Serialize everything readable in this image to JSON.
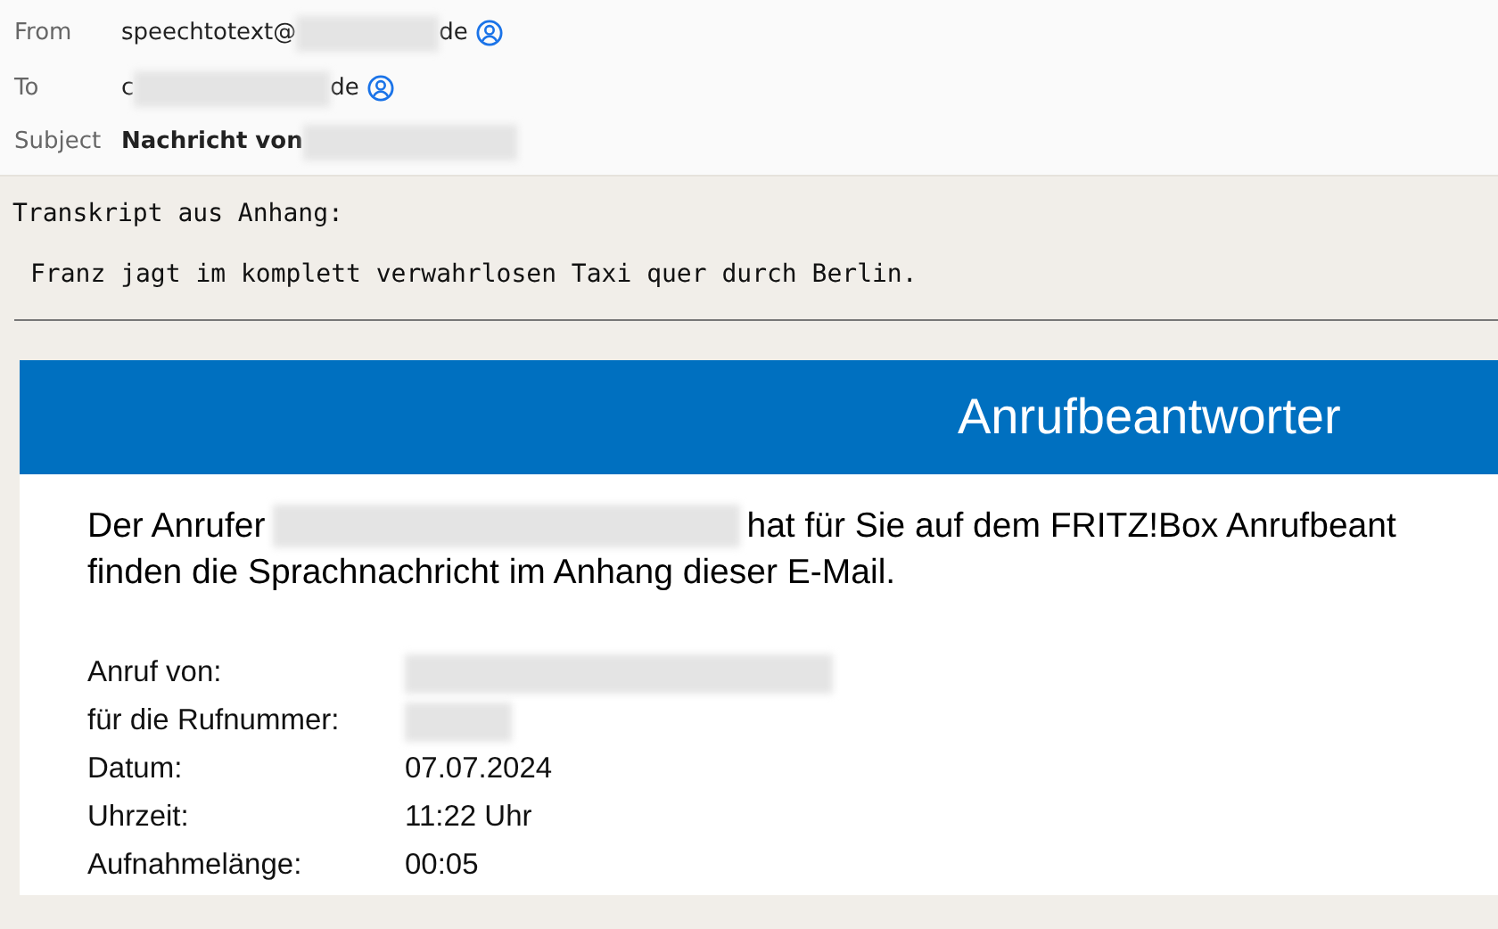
{
  "header": {
    "fields": [
      {
        "label": "From",
        "kind": "address",
        "segments": [
          {
            "kind": "text",
            "text": "speechtotext@"
          },
          {
            "kind": "redaction"
          },
          {
            "kind": "text",
            "text": "de"
          },
          {
            "kind": "contact"
          }
        ]
      },
      {
        "label": "To",
        "kind": "address",
        "segments": [
          {
            "kind": "text",
            "text": "c"
          },
          {
            "kind": "redaction"
          },
          {
            "kind": "text",
            "text": "de"
          },
          {
            "kind": "contact"
          }
        ]
      },
      {
        "label": "Subject",
        "kind": "subject",
        "segments": [
          {
            "kind": "text",
            "text": "Nachricht von"
          },
          {
            "kind": "redaction"
          }
        ]
      }
    ]
  },
  "plain_text": {
    "heading": "Transkript aus Anhang:",
    "transcript": "Franz jagt im komplett verwahrlosen Taxi quer durch Berlin."
  },
  "card": {
    "title": "Anrufbeantworter",
    "message": [
      {
        "segments": [
          {
            "kind": "text",
            "text": "Der Anrufer"
          },
          {
            "kind": "redaction"
          },
          {
            "kind": "text",
            "text": "hat für Sie auf dem FRITZ!Box Anrufbeant"
          }
        ]
      },
      {
        "segments": [
          {
            "kind": "text",
            "text": "finden die Sprachnachricht im Anhang dieser E-Mail."
          }
        ]
      }
    ],
    "details": [
      {
        "label": "Anruf von:",
        "kind": "redaction"
      },
      {
        "label": "für die Rufnummer:",
        "kind": "redaction"
      },
      {
        "label": "Datum:",
        "kind": "text",
        "value": "07.07.2024"
      },
      {
        "label": "Uhrzeit:",
        "kind": "text",
        "value": "11:22 Uhr"
      },
      {
        "label": "Aufnahmelänge:",
        "kind": "text",
        "value": "00:05"
      }
    ]
  }
}
